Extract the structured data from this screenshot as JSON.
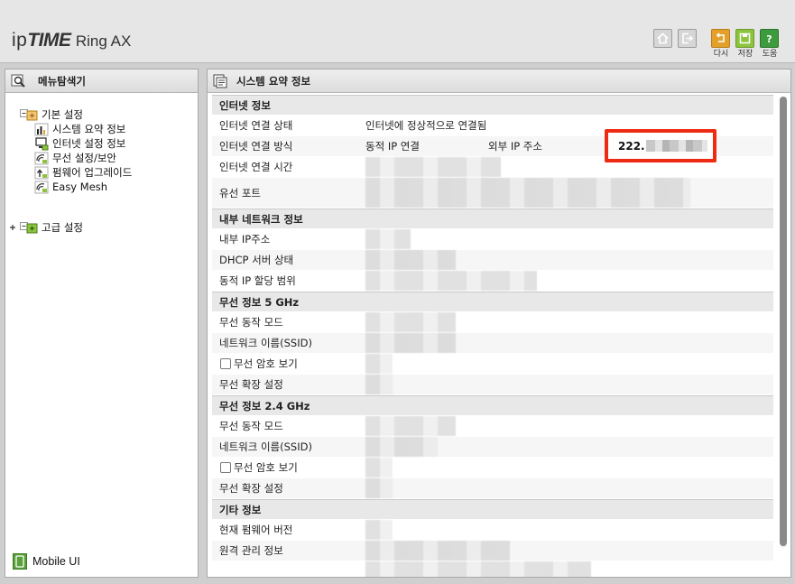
{
  "header": {
    "logo_ip": "ip",
    "logo_time": "TIME",
    "logo_model": "Ring AX",
    "buttons": [
      {
        "icon": "home-icon"
      },
      {
        "icon": "logout-icon"
      },
      {
        "icon": "back-icon",
        "label": "다시",
        "color": "#e3a12b"
      },
      {
        "icon": "save-icon",
        "label": "저장",
        "color": "#8cc43f"
      },
      {
        "icon": "help-icon",
        "label": "도움",
        "color": "#3d9a3d"
      }
    ]
  },
  "sidebar": {
    "title": "메뉴탐색기",
    "groups": [
      {
        "label": "기본 설정",
        "expanded": true,
        "items": [
          {
            "label": "시스템 요약 정보",
            "icon": "chart-icon"
          },
          {
            "label": "인터넷 설정 정보",
            "icon": "monitor-icon"
          },
          {
            "label": "무선 설정/보안",
            "icon": "wireless-icon"
          },
          {
            "label": "펌웨어 업그레이드",
            "icon": "upgrade-icon"
          },
          {
            "label": "Easy Mesh",
            "icon": "wireless-icon"
          }
        ]
      },
      {
        "label": "고급 설정",
        "expanded": false
      }
    ],
    "mobile_ui": "Mobile UI"
  },
  "main": {
    "title": "시스템 요약 정보",
    "sections": [
      {
        "title": "인터넷 정보",
        "rows": [
          {
            "label": "인터넷 연결 상태",
            "value": "인터넷에 정상적으로 연결됨"
          },
          {
            "label": "인터넷 연결 방식",
            "value": "동적 IP 연결",
            "extra_label": "외부 IP 주소",
            "extra_value": "222."
          },
          {
            "label": "인터넷 연결 시간",
            "value": ""
          },
          {
            "label": "유선 포트",
            "value": ""
          }
        ]
      },
      {
        "title": "내부 네트워크 정보",
        "rows": [
          {
            "label": "내부 IP주소",
            "value": ""
          },
          {
            "label": "DHCP 서버 상태",
            "value": ""
          },
          {
            "label": "동적 IP 할당 범위",
            "value": ""
          }
        ]
      },
      {
        "title": "무선 정보 5 GHz",
        "rows": [
          {
            "label": "무선 동작 모드",
            "value": ""
          },
          {
            "label": "네트워크 이름(SSID)",
            "value": ""
          },
          {
            "label": "무선 암호 보기",
            "value": "",
            "checkbox": true
          },
          {
            "label": "무선 확장 설정",
            "value": ""
          }
        ]
      },
      {
        "title": "무선 정보 2.4 GHz",
        "rows": [
          {
            "label": "무선 동작 모드",
            "value": ""
          },
          {
            "label": "네트워크 이름(SSID)",
            "value": ""
          },
          {
            "label": "무선 암호 보기",
            "value": "",
            "checkbox": true
          },
          {
            "label": "무선 확장 설정",
            "value": ""
          }
        ]
      },
      {
        "title": "기타 정보",
        "rows": [
          {
            "label": "현재 펌웨어 버전",
            "value": ""
          },
          {
            "label": "원격 관리 정보",
            "value": ""
          }
        ]
      }
    ]
  }
}
